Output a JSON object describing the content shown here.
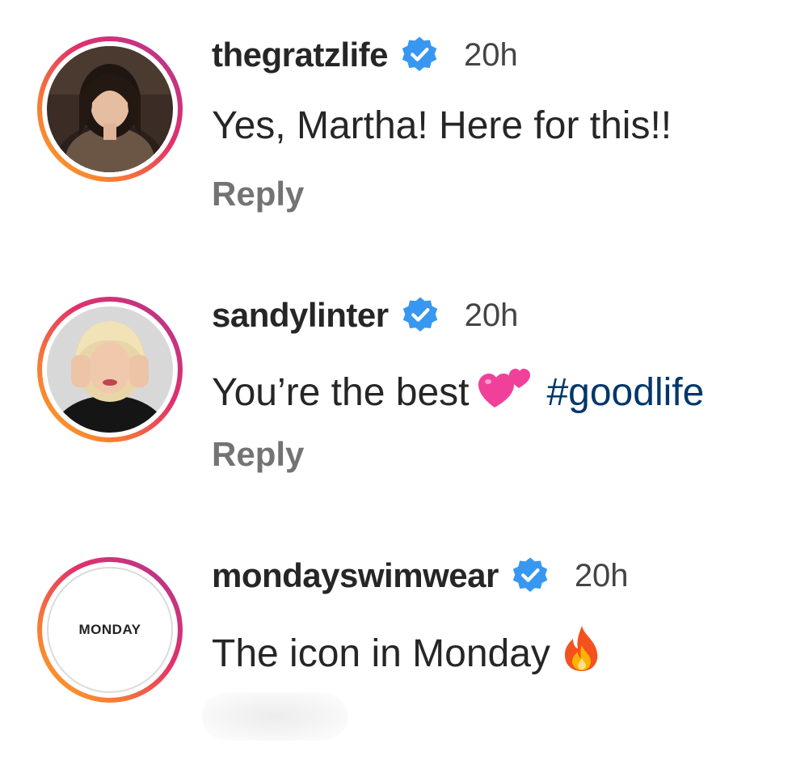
{
  "comments": [
    {
      "username": "thegratzlife",
      "time": "20h",
      "text": "Yes, Martha! Here for this!!",
      "reply_label": "Reply",
      "avatar_icon": "profile-photo"
    },
    {
      "username": "sandylinter",
      "time": "20h",
      "text": "You’re the best",
      "emoji_icon": "two-hearts-emoji",
      "hashtag": "#goodlife",
      "reply_label": "Reply",
      "avatar_icon": "profile-photo"
    },
    {
      "username": "mondayswimwear",
      "time": "20h",
      "text": "The icon in Monday",
      "emoji_icon": "fire-emoji",
      "avatar_text": "MONDAY",
      "avatar_icon": "brand-logo"
    }
  ],
  "colors": {
    "verified_badge": "#3897f0",
    "hashtag": "#00376b",
    "reply": "#737373",
    "story_ring_start": "#f9a825",
    "story_ring_end": "#b01cc9"
  }
}
